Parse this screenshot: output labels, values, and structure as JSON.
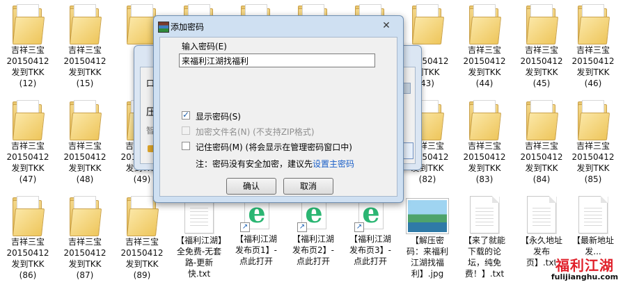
{
  "desktop": {
    "folders": [
      {
        "id": "f12",
        "name": "吉祥三宝",
        "date": "20150412",
        "tag": "发到TKK",
        "num": "(12)"
      },
      {
        "id": "f15",
        "name": "吉祥三宝",
        "date": "20150412",
        "tag": "发到TKK",
        "num": "(15)"
      },
      {
        "id": "f43",
        "name": "",
        "date": "20150412",
        "tag": "到TKK",
        "num": "43)"
      },
      {
        "id": "f44",
        "name": "吉祥三宝",
        "date": "20150412",
        "tag": "发到TKK",
        "num": "(44)"
      },
      {
        "id": "f45",
        "name": "吉祥三宝",
        "date": "20150412",
        "tag": "发到TKK",
        "num": "(45)"
      },
      {
        "id": "f46",
        "name": "吉祥三宝",
        "date": "20150412",
        "tag": "发到TKK",
        "num": "(46)"
      },
      {
        "id": "f47",
        "name": "吉祥三宝",
        "date": "20150412",
        "tag": "发到TKK",
        "num": "(47)"
      },
      {
        "id": "f48",
        "name": "吉祥三宝",
        "date": "20150412",
        "tag": "发到TKK",
        "num": "(48)"
      },
      {
        "id": "f49",
        "name": "吉祥三宝",
        "date": "20150412",
        "tag": "发到TKK",
        "num": "(49)"
      },
      {
        "id": "f82",
        "name": "吉祥三宝",
        "date": "20150412",
        "tag": "发到TKK",
        "num": "(82)"
      },
      {
        "id": "f83",
        "name": "吉祥三宝",
        "date": "20150412",
        "tag": "发到TKK",
        "num": "(83)"
      },
      {
        "id": "f84",
        "name": "吉祥三宝",
        "date": "20150412",
        "tag": "发到TKK",
        "num": "(84)"
      },
      {
        "id": "f85",
        "name": "吉祥三宝",
        "date": "20150412",
        "tag": "发到TKK",
        "num": "(85)"
      },
      {
        "id": "f86",
        "name": "吉祥三宝",
        "date": "20150412",
        "tag": "发到TKK",
        "num": "(86)"
      },
      {
        "id": "f87",
        "name": "吉祥三宝",
        "date": "20150412",
        "tag": "发到TKK",
        "num": "(87)"
      },
      {
        "id": "f89",
        "name": "吉祥三宝",
        "date": "20150412",
        "tag": "发到TKK",
        "num": "(89)"
      }
    ],
    "files": {
      "txt1": "【福利江湖】全免费-无套路-更新快.txt",
      "url1": "【福利江湖发布页1】-点此打开",
      "url2": "【福利江湖发布页2】-点此打开",
      "url3": "【福利江湖发布页3】-点此打开",
      "jpg": "【解压密码：来福利江湖找福利】.jpg",
      "txt2": "【来了就能下载的论坛，纯免费！】.txt",
      "txt3": "【永久地址发布页】.txt",
      "txt4": "【最新地址发..."
    },
    "partial_label_fragments": [
      "吉祥",
      "20150412",
      "发到TK",
      "压",
      "智",
      "口"
    ]
  },
  "dialog": {
    "title": "添加密码",
    "close_glyph": "✕",
    "password_label": "输入密码(E)",
    "password_value": "来福利江湖找福利",
    "show_password_label": "显示密码(S)",
    "show_password_checked": true,
    "encrypt_names_label": "加密文件名(N) (不支持ZIP格式)",
    "remember_label": "记住密码(M) (将会显示在管理密码窗口中)",
    "note_prefix": "注：密码没有安全加密，建议先",
    "note_link": "设置主密码",
    "ok_label": "确认",
    "cancel_label": "取消"
  },
  "watermark": {
    "title": "福利江湖",
    "url": "fulijianghu.com"
  },
  "colors": {
    "dialog_frame": "#cfe0f2",
    "link": "#1a5fc8",
    "watermark_red": "#e0202a"
  }
}
